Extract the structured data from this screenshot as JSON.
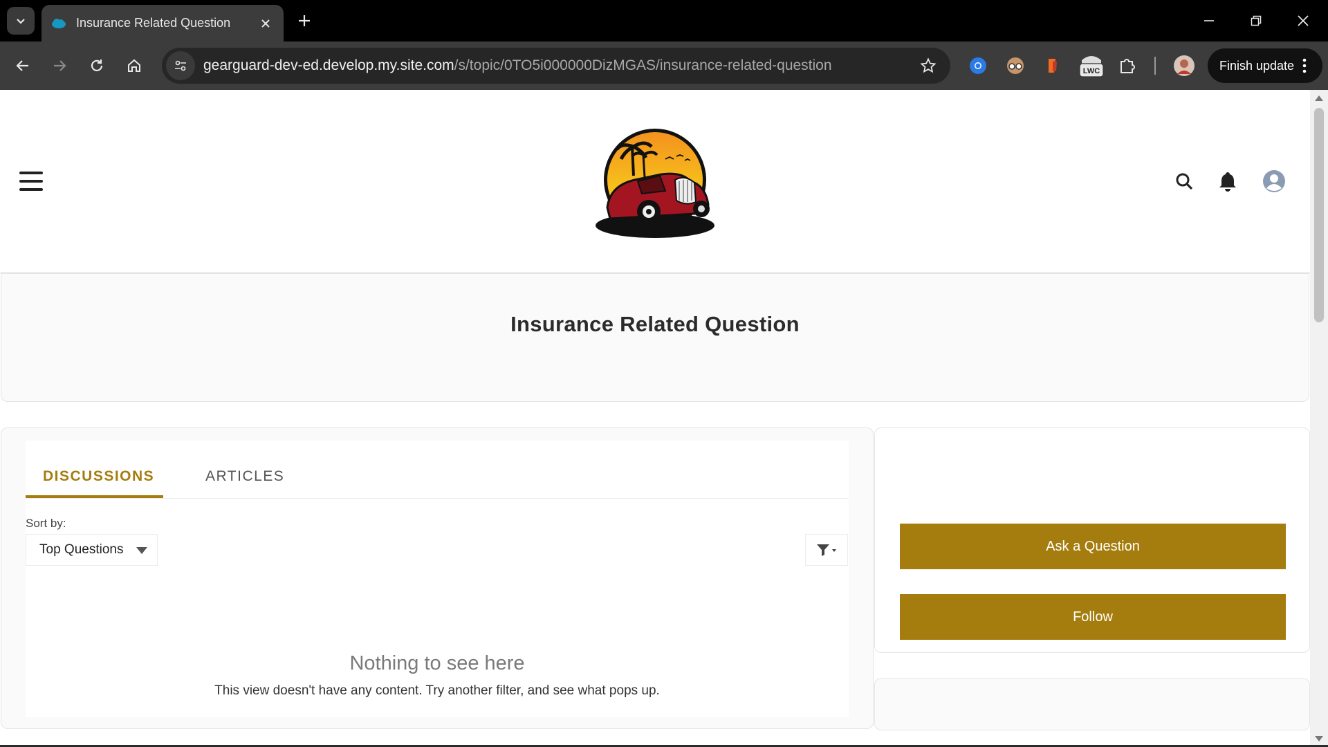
{
  "browser": {
    "tab_title": "Insurance Related Question",
    "url_host": "gearguard-dev-ed.develop.my.site.com",
    "url_path": "/s/topic/0TO5i000000DizMGAS/insurance-related-question",
    "finish_update_label": "Finish update",
    "extensions": [
      "chromium-blue-icon",
      "spy-glasses-icon",
      "orange-tag-icon",
      "lwc-icon",
      "puzzle-piece-icon"
    ],
    "extension_lwc_label": "LWC"
  },
  "header": {
    "logo_alt": "car-sunset-logo"
  },
  "hero": {
    "title": "Insurance Related Question"
  },
  "feed": {
    "tabs": [
      {
        "label": "DISCUSSIONS",
        "active": true
      },
      {
        "label": "ARTICLES",
        "active": false
      }
    ],
    "sort_label": "Sort by:",
    "sort_value": "Top Questions",
    "empty_title": "Nothing to see here",
    "empty_subtitle": "This view doesn't have any content. Try another filter, and see what pops up."
  },
  "sidebar": {
    "ask_label": "Ask a Question",
    "follow_label": "Follow"
  },
  "colors": {
    "brand_gold": "#a57c0e",
    "chrome_dark": "#3c3c3c"
  }
}
